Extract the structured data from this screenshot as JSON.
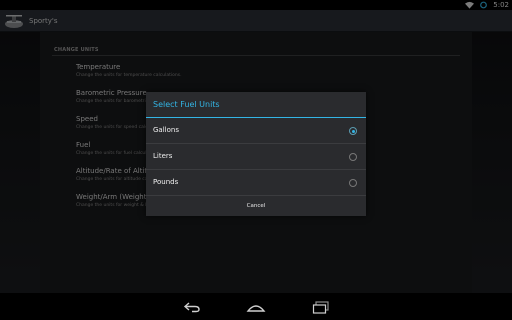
{
  "status_bar": {
    "time": "5:02"
  },
  "action_bar": {
    "title": "Sporty's"
  },
  "settings": {
    "section_header": "CHANGE UNITS",
    "items": [
      {
        "title": "Temperature",
        "summary": "Change the units for temperature calculations."
      },
      {
        "title": "Barometric Pressure",
        "summary": "Change the units for barometric pressure calculations."
      },
      {
        "title": "Speed",
        "summary": "Change the units for speed calculations."
      },
      {
        "title": "Fuel",
        "summary": "Change the units for fuel calculations."
      },
      {
        "title": "Altitude/Rate of Altitude",
        "summary": "Change the units for altitude calculations."
      },
      {
        "title": "Weight/Arm (Weight & Balance)",
        "summary": "Change the units for weight & balance calculations."
      }
    ]
  },
  "dialog": {
    "title": "Select Fuel Units",
    "options": [
      {
        "label": "Gallons",
        "selected": true
      },
      {
        "label": "Liters",
        "selected": false
      },
      {
        "label": "Pounds",
        "selected": false
      }
    ],
    "cancel_label": "Cancel"
  },
  "colors": {
    "accent": "#33b5e5",
    "dialog_bg": "#2a2b2e",
    "action_bar": "#2a2f36"
  }
}
